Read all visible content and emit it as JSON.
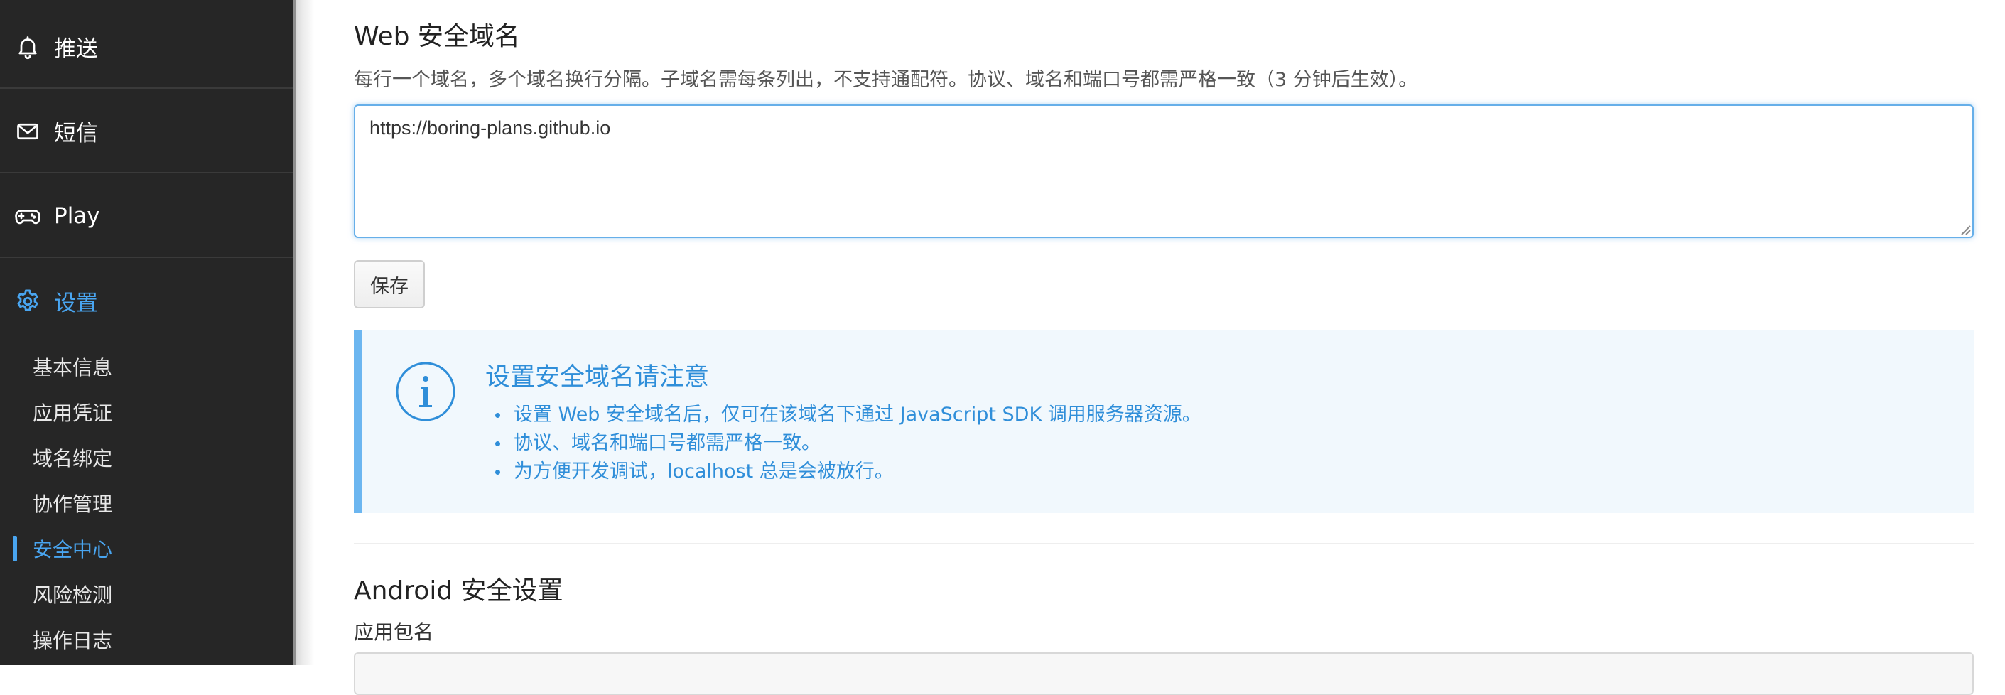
{
  "sidebar": {
    "nav": [
      {
        "label": "推送",
        "icon": "bell-icon",
        "active": false
      },
      {
        "label": "短信",
        "icon": "envelope-icon",
        "active": false
      },
      {
        "label": "Play",
        "icon": "gamepad-icon",
        "active": false
      },
      {
        "label": "设置",
        "icon": "gear-icon",
        "active": true
      }
    ],
    "settings_items": [
      {
        "label": "基本信息",
        "active": false
      },
      {
        "label": "应用凭证",
        "active": false
      },
      {
        "label": "域名绑定",
        "active": false
      },
      {
        "label": "协作管理",
        "active": false
      },
      {
        "label": "安全中心",
        "active": true
      },
      {
        "label": "风险检测",
        "active": false
      },
      {
        "label": "操作日志",
        "active": false
      }
    ]
  },
  "web_security": {
    "title": "Web 安全域名",
    "helper": "每行一个域名，多个域名换行分隔。子域名需每条列出，不支持通配符。协议、域名和端口号都需严格一致（3 分钟后生效）。",
    "domains_value": "https://boring-plans.github.io",
    "save_label": "保存"
  },
  "notice": {
    "icon": "info-circle-icon",
    "title": "设置安全域名请注意",
    "items": [
      "设置 Web 安全域名后，仅可在该域名下通过 JavaScript SDK 调用服务器资源。",
      "协议、域名和端口号都需严格一致。",
      "为方便开发调试，localhost 总是会被放行。"
    ]
  },
  "android_security": {
    "title": "Android 安全设置",
    "package_label": "应用包名",
    "package_value": ""
  },
  "colors": {
    "sidebar_bg": "#262626",
    "accent": "#49a5f0",
    "notice_bg": "#f1f8fd",
    "notice_text": "#2f8ed9"
  }
}
